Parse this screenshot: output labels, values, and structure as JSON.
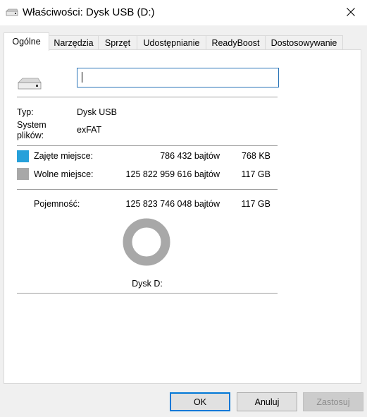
{
  "window": {
    "title": "Właściwości: Dysk USB (D:)",
    "icon": "usb-drive-icon",
    "close_icon": "close-icon"
  },
  "tabs": [
    {
      "label": "Ogólne",
      "active": true
    },
    {
      "label": "Narzędzia",
      "active": false
    },
    {
      "label": "Sprzęt",
      "active": false
    },
    {
      "label": "Udostępnianie",
      "active": false
    },
    {
      "label": "ReadyBoost",
      "active": false
    },
    {
      "label": "Dostosowywanie",
      "active": false
    }
  ],
  "general": {
    "drive_icon": "usb-drive-icon",
    "name_value": "",
    "type_label": "Typ:",
    "type_value": "Dysk USB",
    "fs_label_line1": "System",
    "fs_label_line2": "plików:",
    "fs_value": "exFAT",
    "used": {
      "label": "Zajęte miejsce:",
      "bytes": "786 432 bajtów",
      "size": "768 KB",
      "color": "#26a0da"
    },
    "free": {
      "label": "Wolne miejsce:",
      "bytes": "125 822 959 616 bajtów",
      "size": "117 GB",
      "color": "#a8a8a8"
    },
    "capacity": {
      "label": "Pojemność:",
      "bytes": "125 823 746 048 bajtów",
      "size": "117 GB"
    },
    "donut": {
      "used_fraction": 6.3e-06,
      "used_color": "#26a0da",
      "free_color": "#a8a8a8"
    },
    "drive_caption": "Dysk D:"
  },
  "buttons": {
    "ok": "OK",
    "cancel": "Anuluj",
    "apply": "Zastosuj"
  }
}
